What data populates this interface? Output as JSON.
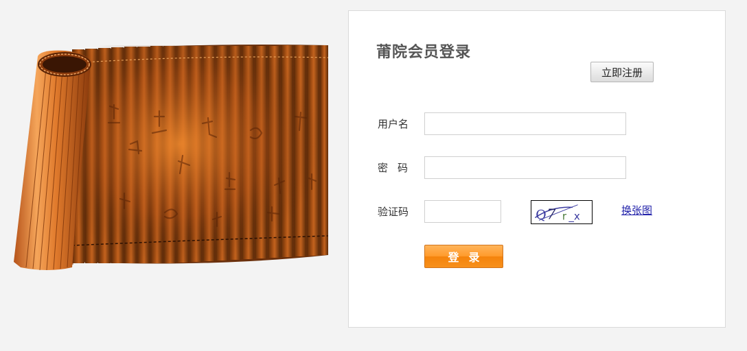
{
  "panel": {
    "title": "莆院会员登录",
    "register_label": "立即注册",
    "change_image_label": "换张图",
    "login_label": "登录"
  },
  "form": {
    "username": {
      "label": "用户名",
      "value": "",
      "placeholder": ""
    },
    "password": {
      "label": "密码",
      "value": "",
      "placeholder": ""
    },
    "captcha": {
      "label": "验证码",
      "value": "",
      "placeholder": "",
      "image_text": "Q7r_x"
    }
  },
  "colors": {
    "page_background": "#f3f3f3",
    "panel_background": "#ffffff",
    "login_button": "#f7901b",
    "link": "#2222aa",
    "bamboo": "#c8621e"
  },
  "icons": {
    "illustration": "bamboo-scroll-illustration"
  }
}
